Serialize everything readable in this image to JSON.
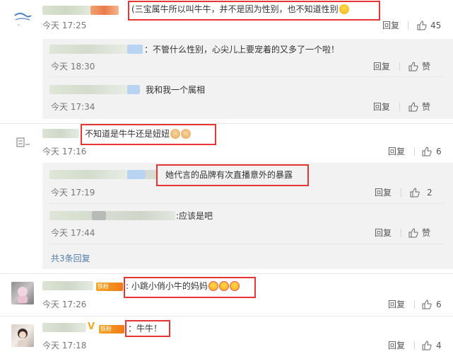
{
  "comments": [
    {
      "text": "(三宝属牛所以叫牛牛，并不是因为性别，也不知道性别",
      "time": "今天 17:25",
      "reply_label": "回复",
      "likes": "45",
      "emoji": "crying-face"
    },
    {
      "text": "不知道是牛牛还是妞妞",
      "time": "今天 17:16",
      "reply_label": "回复",
      "likes": "6",
      "emoji": "cat-face"
    },
    {
      "text": "小跳小俏小牛的妈妈",
      "time": "今天 17:26",
      "reply_label": "回复",
      "likes": "6",
      "emoji": "heart-eyes-face"
    },
    {
      "text": "：牛牛！",
      "time": "今天 17:18",
      "reply_label": "回复",
      "likes": "4"
    }
  ],
  "replies_group1": [
    {
      "text": "：不管什么性别，心尖儿上要宠着的又多了一个啦！",
      "time": "今天 18:30",
      "reply_label": "回复",
      "like_label": "赞"
    },
    {
      "text": "我和我一个属相",
      "time": "今天 17:34",
      "reply_label": "回复",
      "like_label": "赞"
    }
  ],
  "replies_group2": [
    {
      "text": "她代言的品牌有次直播意外的暴露",
      "time": "今天 17:19",
      "reply_label": "回复",
      "likes": "2"
    },
    {
      "text": ":应该是吧",
      "time": "今天 17:44",
      "reply_label": "回复",
      "like_label": "赞"
    }
  ],
  "more_replies": "共3条回复",
  "badge_label": "铁粉",
  "colors": {
    "highlight_border": "#e63535",
    "link": "#507daf",
    "subpanel_bg": "#f2f2f2",
    "verified": "#f5a623"
  }
}
